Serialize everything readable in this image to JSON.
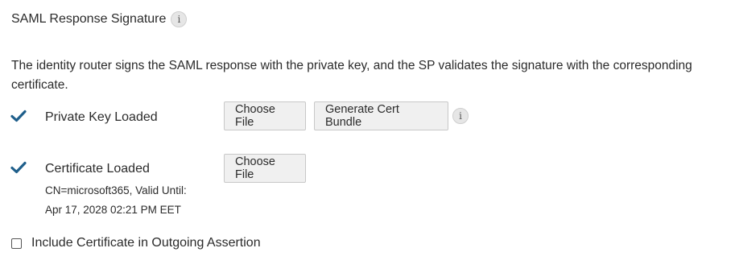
{
  "section": {
    "title": "SAML Response Signature",
    "info_icon": "info-icon"
  },
  "description": "The identity router signs the SAML response with the private key, and the SP validates the signature with the corresponding certificate.",
  "private_key": {
    "status_icon": "checkmark-icon",
    "label": "Private Key Loaded",
    "choose_file_label": "Choose File",
    "generate_label": "Generate Cert Bundle",
    "info_icon": "info-icon"
  },
  "certificate": {
    "status_icon": "checkmark-icon",
    "label": "Certificate Loaded",
    "detail_line1": "CN=microsoft365, Valid Until:",
    "detail_line2": "Apr 17, 2028 02:21 PM EET",
    "choose_file_label": "Choose File"
  },
  "include_certificate": {
    "label": "Include Certificate in Outgoing Assertion",
    "checked": false
  },
  "colors": {
    "check": "#1f5f8b",
    "button_bg": "#f0f0f0",
    "button_border": "#c8c8c8"
  }
}
